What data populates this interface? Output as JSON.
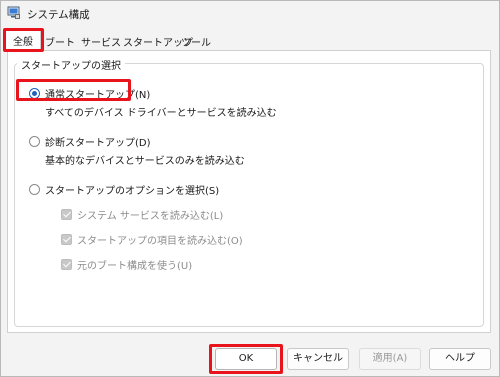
{
  "window": {
    "title": "システム構成",
    "icon": "system-config-icon"
  },
  "tabs": [
    {
      "label": "全般",
      "active": true
    },
    {
      "label": "ブート",
      "active": false
    },
    {
      "label": "サービス",
      "active": false
    },
    {
      "label": "スタートアップ",
      "active": false
    },
    {
      "label": "ツール",
      "active": false
    }
  ],
  "startup_group": {
    "legend": "スタートアップの選択",
    "options": [
      {
        "label": "通常スタートアップ(N)",
        "description": "すべてのデバイス ドライバーとサービスを読み込む",
        "selected": true
      },
      {
        "label": "診断スタートアップ(D)",
        "description": "基本的なデバイスとサービスのみを読み込む",
        "selected": false
      },
      {
        "label": "スタートアップのオプションを選択(S)",
        "selected": false
      }
    ],
    "suboptions": [
      {
        "label": "システム サービスを読み込む(L)",
        "checked": true,
        "disabled": true
      },
      {
        "label": "スタートアップの項目を読み込む(O)",
        "checked": true,
        "disabled": true
      },
      {
        "label": "元のブート構成を使う(U)",
        "checked": true,
        "disabled": true
      }
    ]
  },
  "buttons": {
    "ok": "OK",
    "cancel": "キャンセル",
    "apply": "適用(A)",
    "help": "ヘルプ"
  },
  "colors": {
    "highlight": "#e8131b",
    "accent": "#1f5fbf"
  }
}
